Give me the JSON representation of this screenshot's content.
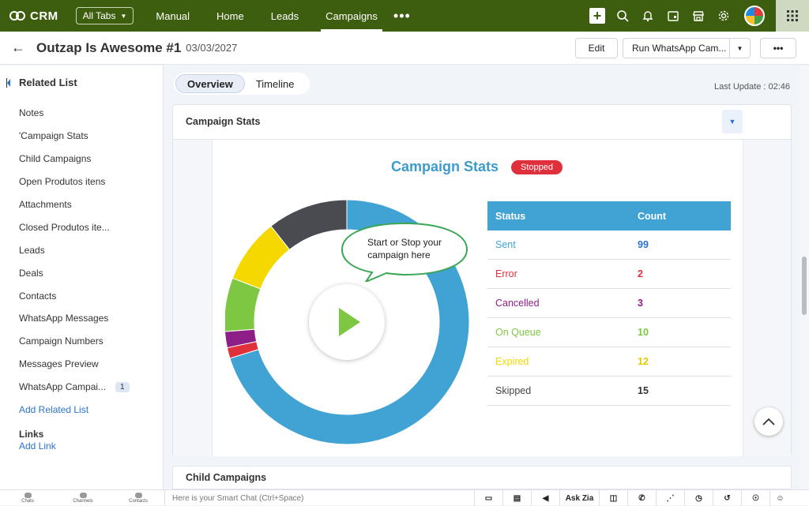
{
  "topbar": {
    "app_name": "CRM",
    "all_tabs_label": "All Tabs",
    "tabs": [
      "Manual",
      "Home",
      "Leads",
      "Campaigns"
    ],
    "active_tab": "Campaigns",
    "more_label": "•••"
  },
  "record": {
    "title": "Outzap Is Awesome #1",
    "date": "03/03/2027",
    "edit_label": "Edit",
    "run_label": "Run WhatsApp Cam...",
    "more_label": "•••"
  },
  "sidebar": {
    "heading": "Related List",
    "items": [
      {
        "label": "Notes"
      },
      {
        "label": "'Campaign Stats"
      },
      {
        "label": "Child Campaigns"
      },
      {
        "label": "Open Produtos itens"
      },
      {
        "label": "Attachments"
      },
      {
        "label": "Closed Produtos ite..."
      },
      {
        "label": "Leads"
      },
      {
        "label": "Deals"
      },
      {
        "label": "Contacts"
      },
      {
        "label": "WhatsApp Messages"
      },
      {
        "label": "Campaign Numbers"
      },
      {
        "label": "Messages Preview"
      },
      {
        "label": "WhatsApp Campai...",
        "badge": "1"
      }
    ],
    "add_related": "Add Related List",
    "links_heading": "Links",
    "add_link": "Add Link"
  },
  "view_tabs": {
    "overview": "Overview",
    "timeline": "Timeline"
  },
  "last_update": "Last Update : 02:46",
  "campaign_card": {
    "title": "Campaign Stats",
    "widget_title": "Campaign Stats",
    "status": "Stopped",
    "tooltip_line1": "Start or Stop your",
    "tooltip_line2": "campaign here",
    "table_headers": [
      "Status",
      "Count"
    ]
  },
  "chart_data": {
    "type": "pie",
    "categories": [
      "Sent",
      "Error",
      "Cancelled",
      "On Queue",
      "Expired",
      "Skipped"
    ],
    "values": [
      99,
      2,
      3,
      10,
      12,
      15
    ],
    "colors": [
      "#41a3d3",
      "#e0303b",
      "#8e1e87",
      "#7dc742",
      "#f5d800",
      "#4a4b50"
    ]
  },
  "child_card": {
    "title": "Child Campaigns"
  },
  "bottombar": {
    "chats": "Chats",
    "channels": "Channels",
    "contacts": "Contacts",
    "smart_chat_placeholder": "Here is your Smart Chat (Ctrl+Space)",
    "ask_zia": "Ask Zia"
  }
}
